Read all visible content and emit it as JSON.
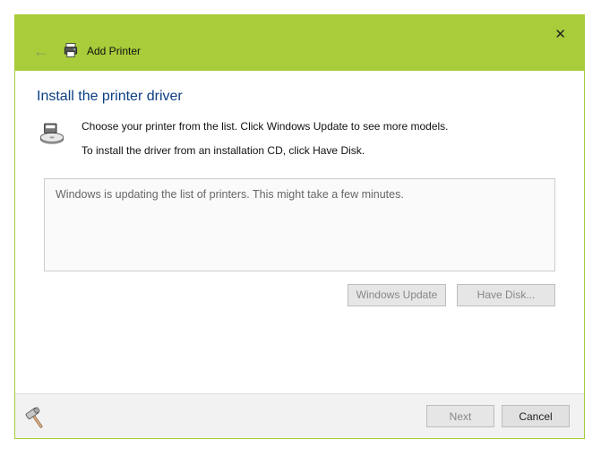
{
  "titlebar": {
    "title": "Add Printer"
  },
  "heading": "Install the printer driver",
  "description": {
    "line1": "Choose your printer from the list. Click Windows Update to see more models.",
    "line2": "To install the driver from an installation CD, click Have Disk."
  },
  "status_message": "Windows is updating the list of printers.  This might take a few minutes.",
  "buttons": {
    "windows_update": "Windows Update",
    "have_disk": "Have Disk...",
    "next": "Next",
    "cancel": "Cancel"
  }
}
